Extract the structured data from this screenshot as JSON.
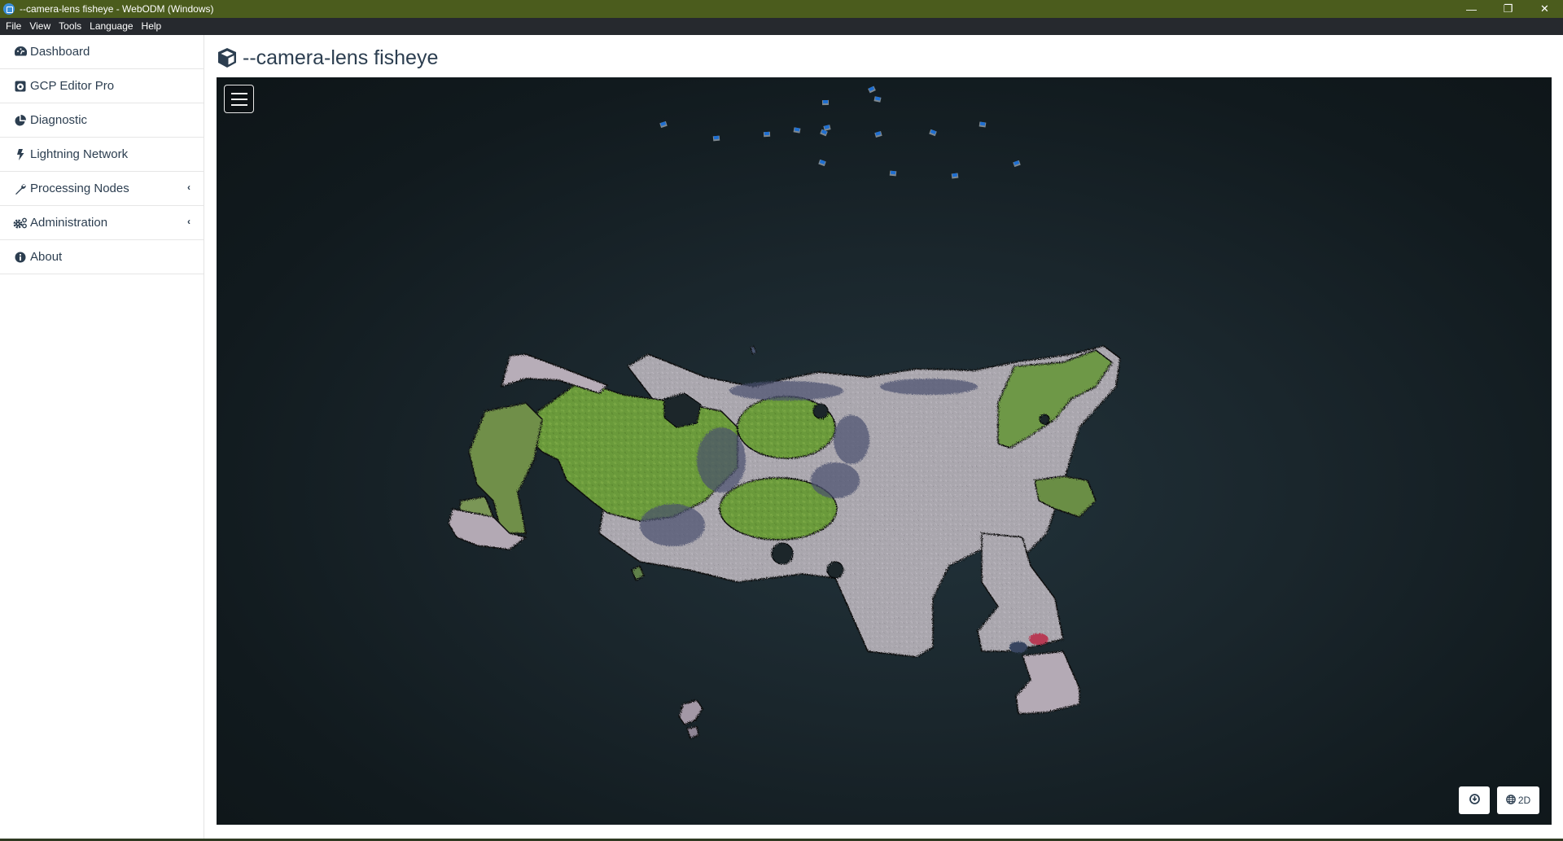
{
  "window": {
    "title": "--camera-lens fisheye - WebODM (Windows)",
    "controls": {
      "minimize": "—",
      "restore": "❐",
      "close": "✕"
    }
  },
  "menubar": {
    "items": [
      "File",
      "View",
      "Tools",
      "Language",
      "Help"
    ]
  },
  "sidebar": {
    "items": [
      {
        "label": "Dashboard",
        "icon": "dashboard-gauge-icon",
        "expandable": false
      },
      {
        "label": "GCP Editor Pro",
        "icon": "gcp-editor-icon",
        "expandable": false
      },
      {
        "label": "Diagnostic",
        "icon": "pie-chart-icon",
        "expandable": false
      },
      {
        "label": "Lightning Network",
        "icon": "lightning-bolt-icon",
        "expandable": false
      },
      {
        "label": "Processing Nodes",
        "icon": "wrench-icon",
        "expandable": true
      },
      {
        "label": "Administration",
        "icon": "gears-icon",
        "expandable": true
      },
      {
        "label": "About",
        "icon": "info-circle-icon",
        "expandable": false
      }
    ]
  },
  "page": {
    "title": "--camera-lens fisheye",
    "title_icon": "cube-icon"
  },
  "viewer": {
    "menu_toggle_icon": "hamburger-menu-icon",
    "buttons": {
      "download": {
        "icon": "download-circle-icon",
        "label": ""
      },
      "view2d": {
        "icon": "globe-icon",
        "label": "2D"
      }
    },
    "colors": {
      "camera_marker": "#1f6fd1",
      "grass": "#6f9a3c",
      "pavement": "#a9a6ad"
    }
  }
}
